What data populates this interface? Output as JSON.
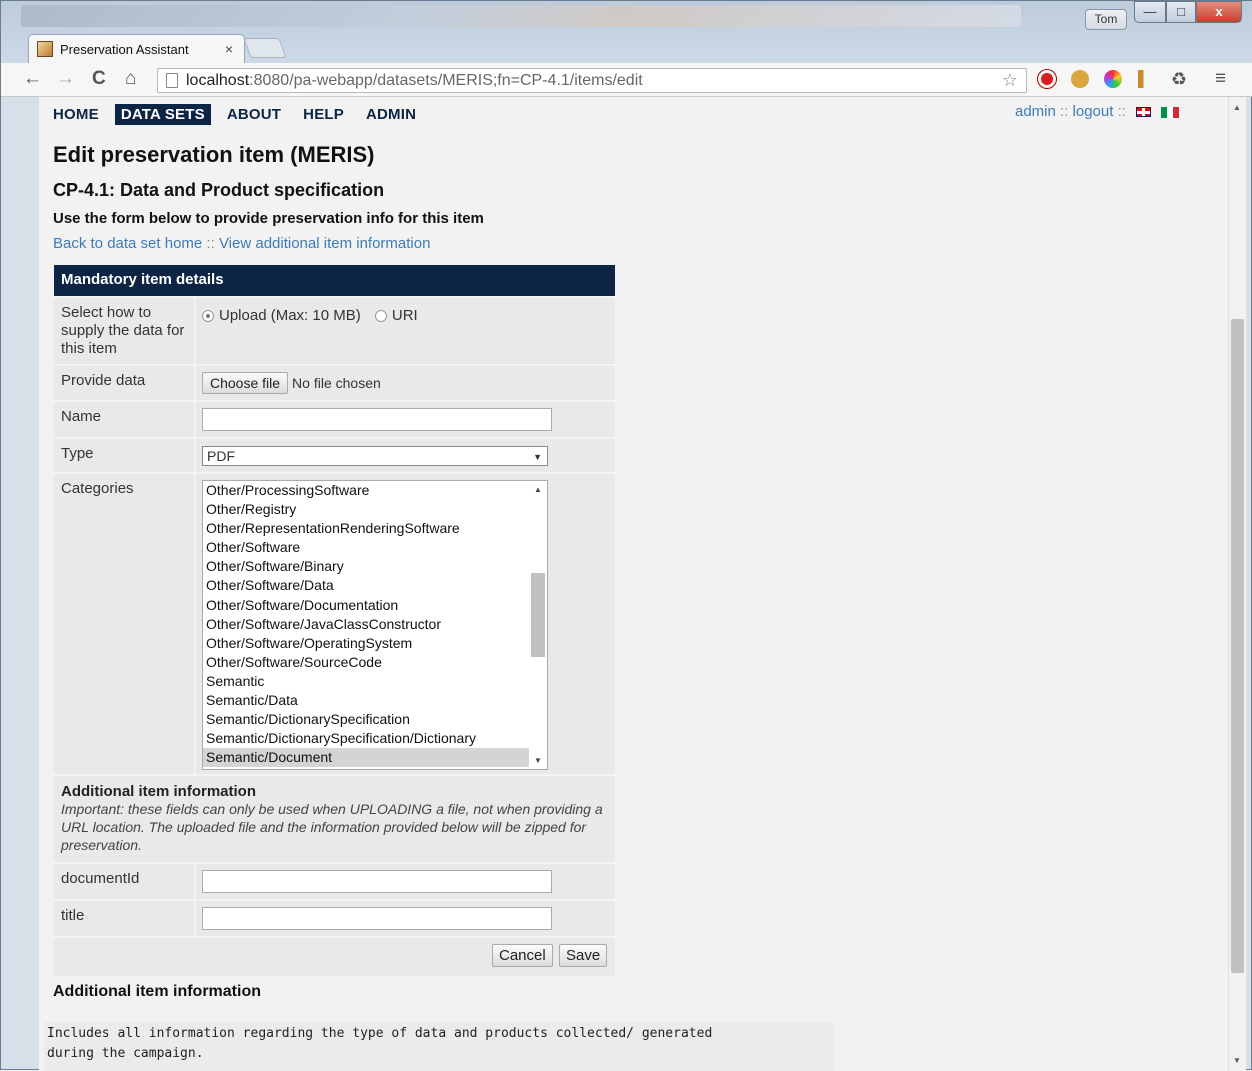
{
  "browser": {
    "tab_title": "Preservation Assistant",
    "tab_close": "×",
    "user_badge": "Tom",
    "url_host": "localhost",
    "url_path": ":8080/pa-webapp/datasets/MERIS;fn=CP-4.1/items/edit",
    "win_min": "—",
    "win_max": "□",
    "win_close": "x"
  },
  "nav": {
    "items": [
      "HOME",
      "DATA SETS",
      "ABOUT",
      "HELP",
      "ADMIN"
    ],
    "active": "DATA SETS",
    "user": "admin",
    "sep": " :: ",
    "logout": "logout"
  },
  "header": {
    "title": "Edit preservation item (MERIS)",
    "subtitle": "CP-4.1: Data and Product specification",
    "instruction": "Use the form below to provide preservation info for this item",
    "back_link": "Back to data set home",
    "link_sep": " :: ",
    "more_link": "View additional item information"
  },
  "form": {
    "section_title": "Mandatory item details",
    "supply_label": "Select how to supply the data for this item",
    "upload_option": "Upload (Max: 10 MB)",
    "uri_option": "URI",
    "provide_label": "Provide data",
    "choose_file": "Choose file",
    "no_file": "No file chosen",
    "name_label": "Name",
    "name_value": "",
    "type_label": "Type",
    "type_value": "PDF",
    "categories_label": "Categories",
    "categories": [
      "Other/ProcessingSoftware",
      "Other/Registry",
      "Other/RepresentationRenderingSoftware",
      "Other/Software",
      "Other/Software/Binary",
      "Other/Software/Data",
      "Other/Software/Documentation",
      "Other/Software/JavaClassConstructor",
      "Other/Software/OperatingSystem",
      "Other/Software/SourceCode",
      "Semantic",
      "Semantic/Data",
      "Semantic/DictionarySpecification",
      "Semantic/DictionarySpecification/Dictionary",
      "Semantic/Document"
    ],
    "selected_category": "Semantic/Document",
    "additional_title": "Additional item information",
    "additional_note": "Important: these fields can only be used when UPLOADING a file, not when providing a URL location. The uploaded file and the information provided below will be zipped for preservation.",
    "document_id_label": "documentId",
    "title_label": "title",
    "cancel": "Cancel",
    "save": "Save"
  },
  "footer": {
    "heading": "Additional item information",
    "text_line1": "Includes all information regarding the type of data and products collected/ generated",
    "text_line2": "during the campaign."
  }
}
